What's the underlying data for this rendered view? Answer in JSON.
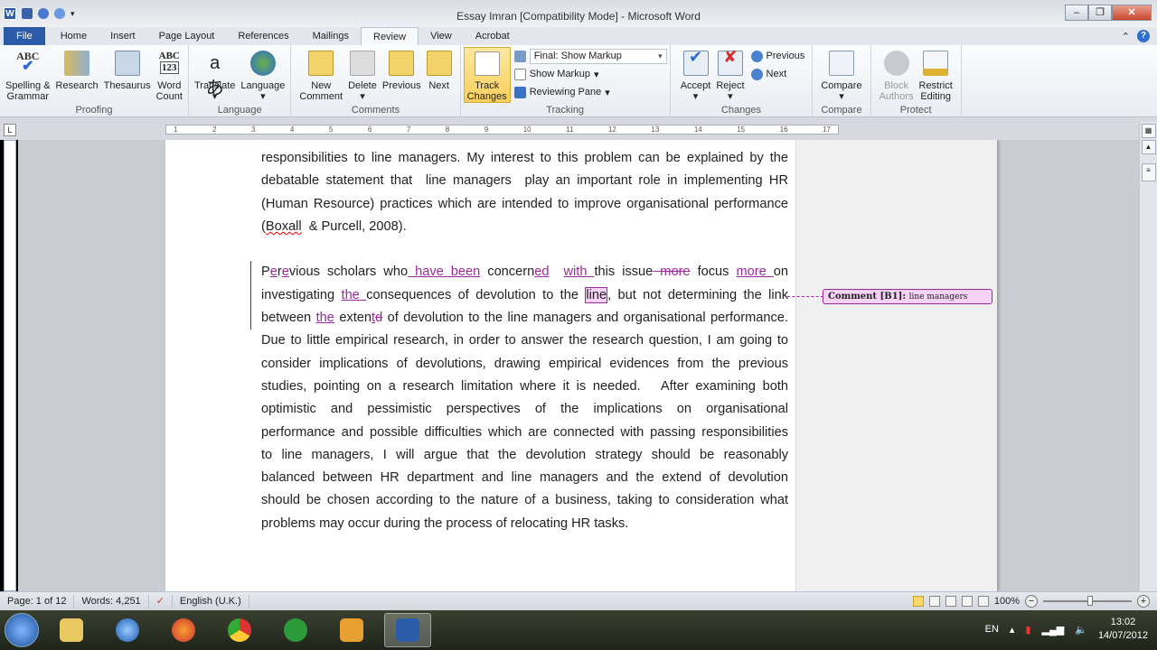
{
  "window": {
    "title": "Essay Imran [Compatibility Mode]  -  Microsoft Word",
    "app_icon": "W"
  },
  "tabs": [
    "File",
    "Home",
    "Insert",
    "Page Layout",
    "References",
    "Mailings",
    "Review",
    "View",
    "Acrobat"
  ],
  "active_tab": "Review",
  "ribbon": {
    "proofing": {
      "label": "Proofing",
      "spelling": "Spelling &",
      "grammar": "Grammar",
      "research": "Research",
      "thesaurus": "Thesaurus",
      "word": "Word",
      "count": "Count",
      "abc": "ABC",
      "abc123": "123"
    },
    "language": {
      "label": "Language",
      "translate": "Translate",
      "language": "Language"
    },
    "comments": {
      "label": "Comments",
      "new1": "New",
      "new2": "Comment",
      "delete": "Delete",
      "previous": "Previous",
      "next": "Next"
    },
    "tracking": {
      "label": "Tracking",
      "track1": "Track",
      "track2": "Changes",
      "display": "Final: Show Markup",
      "show_markup": "Show Markup",
      "reviewing_pane": "Reviewing Pane"
    },
    "changes": {
      "label": "Changes",
      "accept": "Accept",
      "reject": "Reject",
      "previous": "Previous",
      "next": "Next"
    },
    "compare": {
      "label": "Compare",
      "compare": "Compare"
    },
    "protect": {
      "label": "Protect",
      "block1": "Block",
      "block2": "Authors",
      "restrict1": "Restrict",
      "restrict2": "Editing"
    }
  },
  "ruler": {
    "ticks": [
      "1",
      "2",
      "3",
      "4",
      "5",
      "6",
      "7",
      "8",
      "9",
      "10",
      "11",
      "12",
      "13",
      "14",
      "15",
      "16",
      "17"
    ],
    "tab_selector": "L"
  },
  "document": {
    "paragraphs": [
      {
        "lines": [
          [
            {
              "t": "responsibilities to line managers. My interest to this problem can be explained by the",
              "k": "n"
            }
          ],
          [
            {
              "t": "debatable statement that  line managers  play an important role in implementing HR",
              "k": "n"
            }
          ],
          [
            {
              "t": "(Human Resource) practices which are intended to improve organisational performance",
              "k": "n"
            }
          ],
          [
            {
              "t": "(",
              "k": "n"
            },
            {
              "t": "Boxall",
              "k": "spell"
            },
            {
              "t": "  & Purcell, 2008).",
              "k": "n"
            }
          ]
        ]
      },
      {
        "tracked": true,
        "lines": [
          [
            {
              "t": "P",
              "k": "n"
            },
            {
              "t": "e",
              "k": "ins"
            },
            {
              "t": "r",
              "k": "n"
            },
            {
              "t": "e",
              "k": "ins"
            },
            {
              "t": "vious scholars who",
              "k": "n"
            },
            {
              "t": " have been",
              "k": "ins"
            },
            {
              "t": " concern",
              "k": "n"
            },
            {
              "t": "ed",
              "k": "ins"
            },
            {
              "t": "  ",
              "k": "n"
            },
            {
              "t": "with ",
              "k": "ins"
            },
            {
              "t": "this issue",
              "k": "n"
            },
            {
              "t": " more",
              "k": "del"
            },
            {
              "t": " focus ",
              "k": "n"
            },
            {
              "t": "more ",
              "k": "ins"
            },
            {
              "t": "on",
              "k": "n"
            }
          ],
          [
            {
              "t": "investigating ",
              "k": "n"
            },
            {
              "t": "the ",
              "k": "ins"
            },
            {
              "t": "consequences of devolution to the ",
              "k": "n"
            },
            {
              "t": "line",
              "k": "com"
            },
            {
              "t": ", but not determining the link",
              "k": "n"
            }
          ],
          [
            {
              "t": "between ",
              "k": "n"
            },
            {
              "t": "the",
              "k": "ins"
            },
            {
              "t": " exten",
              "k": "n"
            },
            {
              "t": "t",
              "k": "ins"
            },
            {
              "t": "d",
              "k": "del"
            },
            {
              "t": " of devolution to the line managers and organisational performance.",
              "k": "n"
            }
          ],
          [
            {
              "t": "Due to little empirical research, in order to answer the research question, I am going to",
              "k": "n"
            }
          ],
          [
            {
              "t": "consider implications of devolutions, drawing empirical evidences from the previous",
              "k": "n"
            }
          ],
          [
            {
              "t": "studies, pointing on a research limitation where it is needed.   After examining both",
              "k": "n"
            }
          ],
          [
            {
              "t": "optimistic and pessimistic perspectives of the implications on organisational",
              "k": "n"
            }
          ],
          [
            {
              "t": "performance and possible difficulties which are connected with passing responsibilities",
              "k": "n"
            }
          ],
          [
            {
              "t": "to line managers, I will argue that the devolution strategy should be reasonably",
              "k": "n"
            }
          ],
          [
            {
              "t": "balanced between HR department and line managers and the extend of devolution",
              "k": "n"
            }
          ],
          [
            {
              "t": "should be chosen according to the nature of a business, taking to consideration what",
              "k": "n"
            }
          ],
          [
            {
              "t": "problems may occur during the process of relocating HR tasks.",
              "k": "n"
            }
          ]
        ]
      }
    ],
    "comment": {
      "label": "Comment [B1]:",
      "text": "line managers"
    }
  },
  "status": {
    "page": "Page: 1 of 12",
    "words": "Words: 4,251",
    "language": "English (U.K.)",
    "zoom": "100%",
    "zoom_percent": 100
  },
  "taskbar": {
    "apps": [
      "explorer",
      "itunes",
      "firefox",
      "chrome",
      "utorrent",
      "network-app",
      "word"
    ],
    "lang": "EN",
    "time": "13:02",
    "date": "14/07/2012"
  },
  "colors": {
    "revision": "#9a2a9a",
    "comment_bg": "#f6d2f6",
    "file_tab": "#2b5ba8"
  }
}
